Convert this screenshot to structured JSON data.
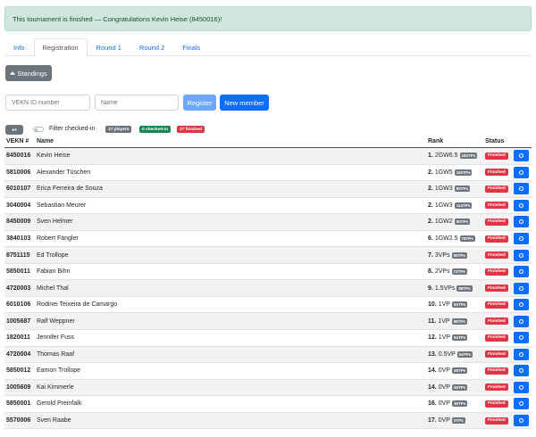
{
  "alert": {
    "text": "This tournament is finished — Congratulations Kevin Heise (8450016)!"
  },
  "tabs": [
    {
      "label": "Info",
      "active": false
    },
    {
      "label": "Registration",
      "active": true
    },
    {
      "label": "Round 1",
      "active": false
    },
    {
      "label": "Round 2",
      "active": false
    },
    {
      "label": "Finals",
      "active": false
    }
  ],
  "toolbar": {
    "standings_label": "Standings"
  },
  "register": {
    "vekn_placeholder": "VEKN ID number",
    "name_placeholder": "Name",
    "register_label": "Register",
    "new_member_label": "New member"
  },
  "filter": {
    "label": "Filter checked-in",
    "players_badge": "17 players",
    "checked_badge": "0 checked-in",
    "finished_badge": "17 finished"
  },
  "table": {
    "headers": {
      "id": "VEKN #",
      "name": "Name",
      "rank": "Rank",
      "status": "Status"
    },
    "rows": [
      {
        "id": "8450016",
        "name": "Kevin Heise",
        "rank": "1.",
        "score": "2GW6.5",
        "tps": "162TPs",
        "status": "Finished"
      },
      {
        "id": "5810006",
        "name": "Alexander Tüschen",
        "rank": "2.",
        "score": "1GW5",
        "tps": "162TPs",
        "status": "Finished"
      },
      {
        "id": "6010107",
        "name": "Erica Ferreira de Souza",
        "rank": "2.",
        "score": "1GW3",
        "tps": "90TPs",
        "status": "Finished"
      },
      {
        "id": "3040004",
        "name": "Sebastian Meurer",
        "rank": "2.",
        "score": "1GW3",
        "tps": "114TPs",
        "status": "Finished"
      },
      {
        "id": "8450009",
        "name": "Sven Helmer",
        "rank": "2.",
        "score": "1GW2",
        "tps": "90TPs",
        "status": "Finished"
      },
      {
        "id": "3840103",
        "name": "Robert Fängler",
        "rank": "6.",
        "score": "1GW2.5",
        "tps": "78TPs",
        "status": "Finished"
      },
      {
        "id": "8751115",
        "name": "Ed Trollope",
        "rank": "7.",
        "score": "3VPs",
        "tps": "90TPs",
        "status": "Finished"
      },
      {
        "id": "5850011",
        "name": "Fabian Bihn",
        "rank": "8.",
        "score": "2VPs",
        "tps": "72TPs",
        "status": "Finished"
      },
      {
        "id": "4720003",
        "name": "Michel Thal",
        "rank": "9.",
        "score": "1.5VPs",
        "tps": "88TPs",
        "status": "Finished"
      },
      {
        "id": "6010106",
        "name": "Rodinei Teixeira de Camargo",
        "rank": "10.",
        "score": "1VP",
        "tps": "84TPs",
        "status": "Finished"
      },
      {
        "id": "1005687",
        "name": "Ralf Weppner",
        "rank": "11.",
        "score": "1VP",
        "tps": "66TPs",
        "status": "Finished"
      },
      {
        "id": "1820011",
        "name": "Jennifer Fuss",
        "rank": "12.",
        "score": "1VP",
        "tps": "54TPs",
        "status": "Finished"
      },
      {
        "id": "4720004",
        "name": "Thomas Raaf",
        "rank": "13.",
        "score": "0.5VP",
        "tps": "54TPs",
        "status": "Finished"
      },
      {
        "id": "5850012",
        "name": "Eamon Trollope",
        "rank": "14.",
        "score": "0VP",
        "tps": "46TPs",
        "status": "Finished"
      },
      {
        "id": "1005609",
        "name": "Kai Kimmerle",
        "rank": "14.",
        "score": "0VP",
        "tps": "46TPs",
        "status": "Finished"
      },
      {
        "id": "5850001",
        "name": "Gerold Preinfalk",
        "rank": "16.",
        "score": "0VP",
        "tps": "36TPs",
        "status": "Finished"
      },
      {
        "id": "5570006",
        "name": "Sven Raabe",
        "rank": "17.",
        "score": "0VP",
        "tps": "0TPs",
        "status": "Finished"
      }
    ]
  }
}
